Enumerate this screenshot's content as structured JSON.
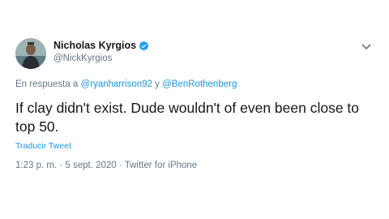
{
  "tweet": {
    "author": {
      "display_name": "Nicholas Kyrgios",
      "handle": "@NickKyrgios",
      "verified": true,
      "avatar_icon": "avatar-photo"
    },
    "reply": {
      "prefix": "En respuesta a",
      "mention_1": "@ryanharrison92",
      "conjunction": "y",
      "mention_2": "@BenRothenberg"
    },
    "text": "If clay didn't exist. Dude wouldn't of even been close to top 50.",
    "translate_label": "Traducir Tweet",
    "timestamp": "1:23 p. m. · 5 sept. 2020",
    "separator": "·",
    "source": "Twitter for iPhone"
  },
  "colors": {
    "link": "#1b95e0",
    "muted": "#657786",
    "text": "#14171a",
    "verified": "#1da1f2"
  },
  "icons": {
    "verified": "verified-badge-icon",
    "more": "chevron-down-icon"
  }
}
